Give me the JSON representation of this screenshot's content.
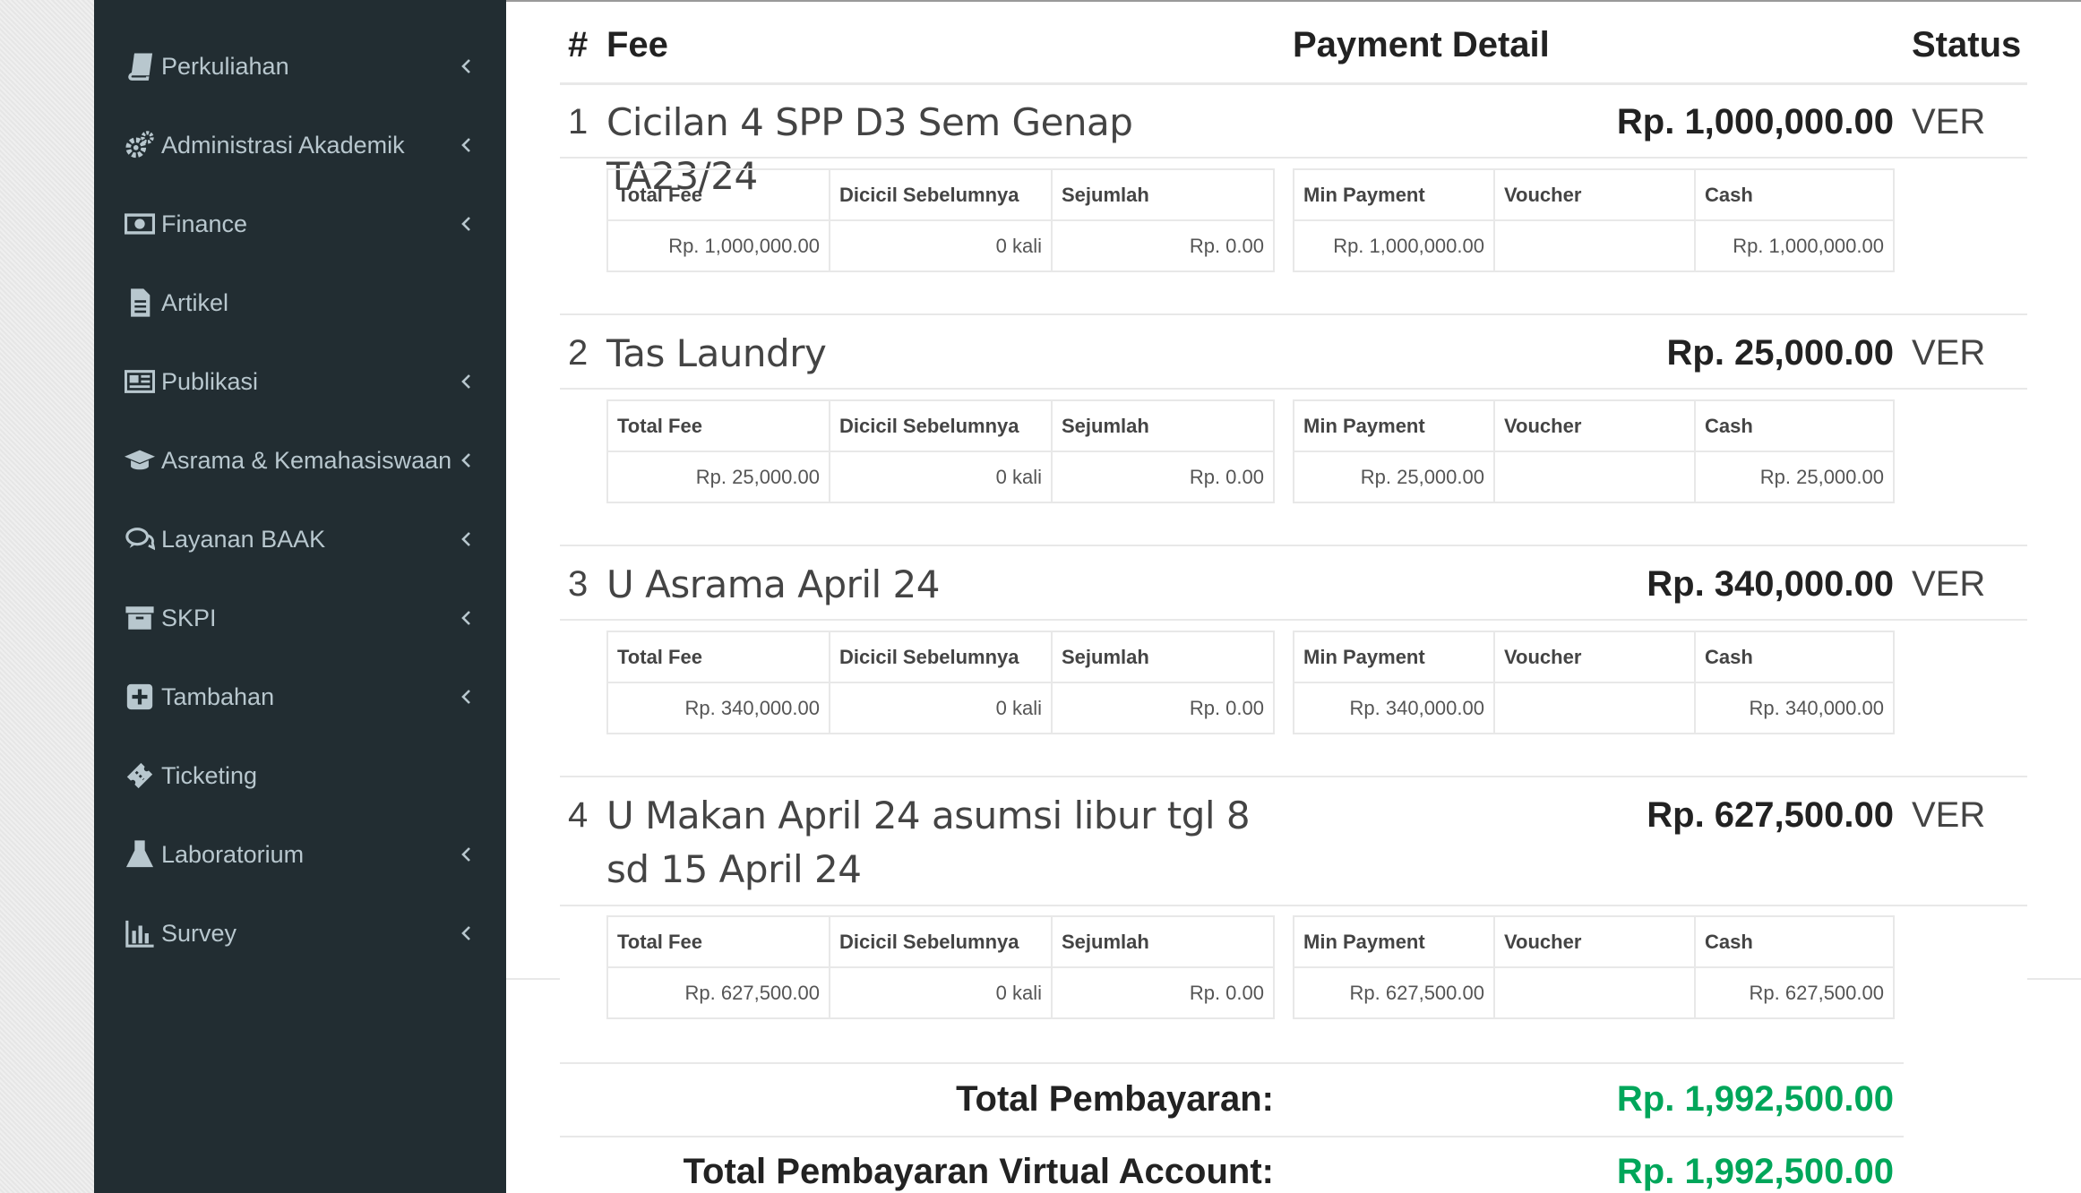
{
  "sidebar": {
    "items": [
      {
        "label": "Perkuliahan",
        "icon": "book-icon",
        "has_submenu": true
      },
      {
        "label": "Administrasi Akademik",
        "icon": "cogs-icon",
        "has_submenu": true
      },
      {
        "label": "Finance",
        "icon": "money-icon",
        "has_submenu": true
      },
      {
        "label": "Artikel",
        "icon": "file-text-icon",
        "has_submenu": false
      },
      {
        "label": "Publikasi",
        "icon": "newspaper-icon",
        "has_submenu": true
      },
      {
        "label": "Asrama & Kemahasiswaan",
        "icon": "graduation-cap-icon",
        "has_submenu": true
      },
      {
        "label": "Layanan BAAK",
        "icon": "comments-icon",
        "has_submenu": true
      },
      {
        "label": "SKPI",
        "icon": "archive-icon",
        "has_submenu": true
      },
      {
        "label": "Tambahan",
        "icon": "plus-square-icon",
        "has_submenu": true
      },
      {
        "label": "Ticketing",
        "icon": "ticket-icon",
        "has_submenu": false
      },
      {
        "label": "Laboratorium",
        "icon": "flask-icon",
        "has_submenu": true
      },
      {
        "label": "Survey",
        "icon": "bar-chart-icon",
        "has_submenu": true
      }
    ]
  },
  "table": {
    "headers": {
      "no": "#",
      "fee": "Fee",
      "detail": "Payment Detail",
      "status": "Status"
    },
    "sub_headers": [
      "Total Fee",
      "Dicicil Sebelumnya",
      "Sejumlah",
      "Min Payment",
      "Voucher",
      "Cash"
    ],
    "rows": [
      {
        "no": "1",
        "name": "Cicilan 4 SPP D3 Sem Genap TA23/24",
        "amount": "Rp. 1,000,000.00",
        "status": "VER",
        "total_fee": "Rp. 1,000,000.00",
        "dicicil": "0 kali",
        "sejumlah": "Rp. 0.00",
        "min_payment": "Rp. 1,000,000.00",
        "voucher": "",
        "cash": "Rp. 1,000,000.00"
      },
      {
        "no": "2",
        "name": "Tas Laundry",
        "amount": "Rp. 25,000.00",
        "status": "VER",
        "total_fee": "Rp. 25,000.00",
        "dicicil": "0 kali",
        "sejumlah": "Rp. 0.00",
        "min_payment": "Rp. 25,000.00",
        "voucher": "",
        "cash": "Rp. 25,000.00"
      },
      {
        "no": "3",
        "name": "U Asrama April 24",
        "amount": "Rp. 340,000.00",
        "status": "VER",
        "total_fee": "Rp. 340,000.00",
        "dicicil": "0 kali",
        "sejumlah": "Rp. 0.00",
        "min_payment": "Rp. 340,000.00",
        "voucher": "",
        "cash": "Rp. 340,000.00"
      },
      {
        "no": "4",
        "name": "U Makan April 24 asumsi libur tgl 8 sd 15 April 24",
        "amount": "Rp. 627,500.00",
        "status": "VER",
        "total_fee": "Rp. 627,500.00",
        "dicicil": "0 kali",
        "sejumlah": "Rp. 0.00",
        "min_payment": "Rp. 627,500.00",
        "voucher": "",
        "cash": "Rp. 627,500.00"
      }
    ]
  },
  "totals": {
    "total_label": "Total Pembayaran:",
    "total_value": "Rp. 1,992,500.00",
    "va_label": "Total Pembayaran Virtual Account:",
    "va_value": "Rp. 1,992,500.00"
  },
  "colors": {
    "sidebar_bg": "#222d32",
    "sidebar_text": "#b8c7ce",
    "total_green": "#00a65a"
  }
}
